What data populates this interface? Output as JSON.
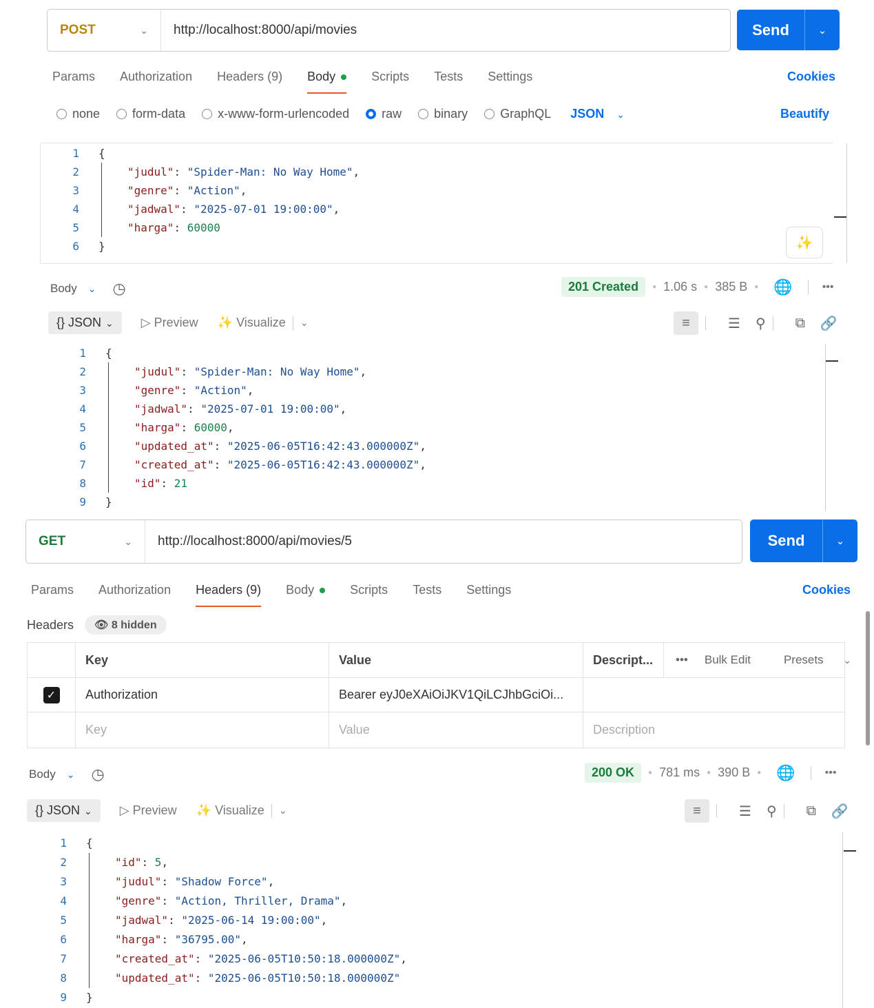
{
  "post": {
    "method": "POST",
    "url": "http://localhost:8000/api/movies",
    "send_label": "Send",
    "tabs": [
      "Params",
      "Authorization",
      "Headers (9)",
      "Body",
      "Scripts",
      "Tests",
      "Settings"
    ],
    "cookies": "Cookies",
    "body_options": [
      "none",
      "form-data",
      "x-www-form-urlencoded",
      "raw",
      "binary",
      "GraphQL"
    ],
    "body_format": "JSON",
    "beautify": "Beautify",
    "request_lines": [
      {
        "num": "1",
        "code": "{"
      },
      {
        "num": "2",
        "key": "\"judul\"",
        "val": "\"Spider-Man: No Way Home\"",
        "suffix": ","
      },
      {
        "num": "3",
        "key": "\"genre\"",
        "val": "\"Action\"",
        "suffix": ","
      },
      {
        "num": "4",
        "key": "\"jadwal\"",
        "val": "\"2025-07-01 19:00:00\"",
        "suffix": ","
      },
      {
        "num": "5",
        "key": "\"harga\"",
        "num_val": "60000",
        "suffix": ""
      },
      {
        "num": "6",
        "code": "}"
      }
    ],
    "response": {
      "body_label": "Body",
      "status": "201 Created",
      "time": "1.06 s",
      "size": "385 B",
      "format": "{} JSON",
      "preview": "Preview",
      "visualize": "Visualize",
      "lines": [
        {
          "num": "1",
          "code": "{"
        },
        {
          "num": "2",
          "key": "\"judul\"",
          "val": "\"Spider-Man: No Way Home\"",
          "suffix": ","
        },
        {
          "num": "3",
          "key": "\"genre\"",
          "val": "\"Action\"",
          "suffix": ","
        },
        {
          "num": "4",
          "key": "\"jadwal\"",
          "val": "\"2025-07-01 19:00:00\"",
          "suffix": ","
        },
        {
          "num": "5",
          "key": "\"harga\"",
          "num_val": "60000",
          "suffix": ","
        },
        {
          "num": "6",
          "key": "\"updated_at\"",
          "val": "\"2025-06-05T16:42:43.000000Z\"",
          "suffix": ","
        },
        {
          "num": "7",
          "key": "\"created_at\"",
          "val": "\"2025-06-05T16:42:43.000000Z\"",
          "suffix": ","
        },
        {
          "num": "8",
          "key": "\"id\"",
          "num_val": "21",
          "suffix": ""
        },
        {
          "num": "9",
          "code": "}"
        }
      ]
    }
  },
  "get": {
    "method": "GET",
    "url": "http://localhost:8000/api/movies/5",
    "send_label": "Send",
    "tabs": [
      "Params",
      "Authorization",
      "Headers (9)",
      "Body",
      "Scripts",
      "Tests",
      "Settings"
    ],
    "cookies": "Cookies",
    "headers_title": "Headers",
    "hidden_count": "8 hidden",
    "table": {
      "col_key": "Key",
      "col_value": "Value",
      "col_desc": "Descript...",
      "bulk_edit": "Bulk Edit",
      "presets": "Presets",
      "row_key": "Authorization",
      "row_value": "Bearer eyJ0eXAiOiJKV1QiLCJhbGciOi...",
      "ph_key": "Key",
      "ph_value": "Value",
      "ph_desc": "Description"
    },
    "response": {
      "body_label": "Body",
      "status": "200 OK",
      "time": "781 ms",
      "size": "390 B",
      "format": "{} JSON",
      "preview": "Preview",
      "visualize": "Visualize",
      "lines": [
        {
          "num": "1",
          "code": "{"
        },
        {
          "num": "2",
          "key": "\"id\"",
          "num_val": "5",
          "suffix": ","
        },
        {
          "num": "3",
          "key": "\"judul\"",
          "val": "\"Shadow Force\"",
          "suffix": ","
        },
        {
          "num": "4",
          "key": "\"genre\"",
          "val": "\"Action, Thriller, Drama\"",
          "suffix": ","
        },
        {
          "num": "5",
          "key": "\"jadwal\"",
          "val": "\"2025-06-14 19:00:00\"",
          "suffix": ","
        },
        {
          "num": "6",
          "key": "\"harga\"",
          "val": "\"36795.00\"",
          "suffix": ","
        },
        {
          "num": "7",
          "key": "\"created_at\"",
          "val": "\"2025-06-05T10:50:18.000000Z\"",
          "suffix": ","
        },
        {
          "num": "8",
          "key": "\"updated_at\"",
          "val": "\"2025-06-05T10:50:18.000000Z\"",
          "suffix": ""
        },
        {
          "num": "9",
          "code": "}"
        }
      ]
    }
  }
}
